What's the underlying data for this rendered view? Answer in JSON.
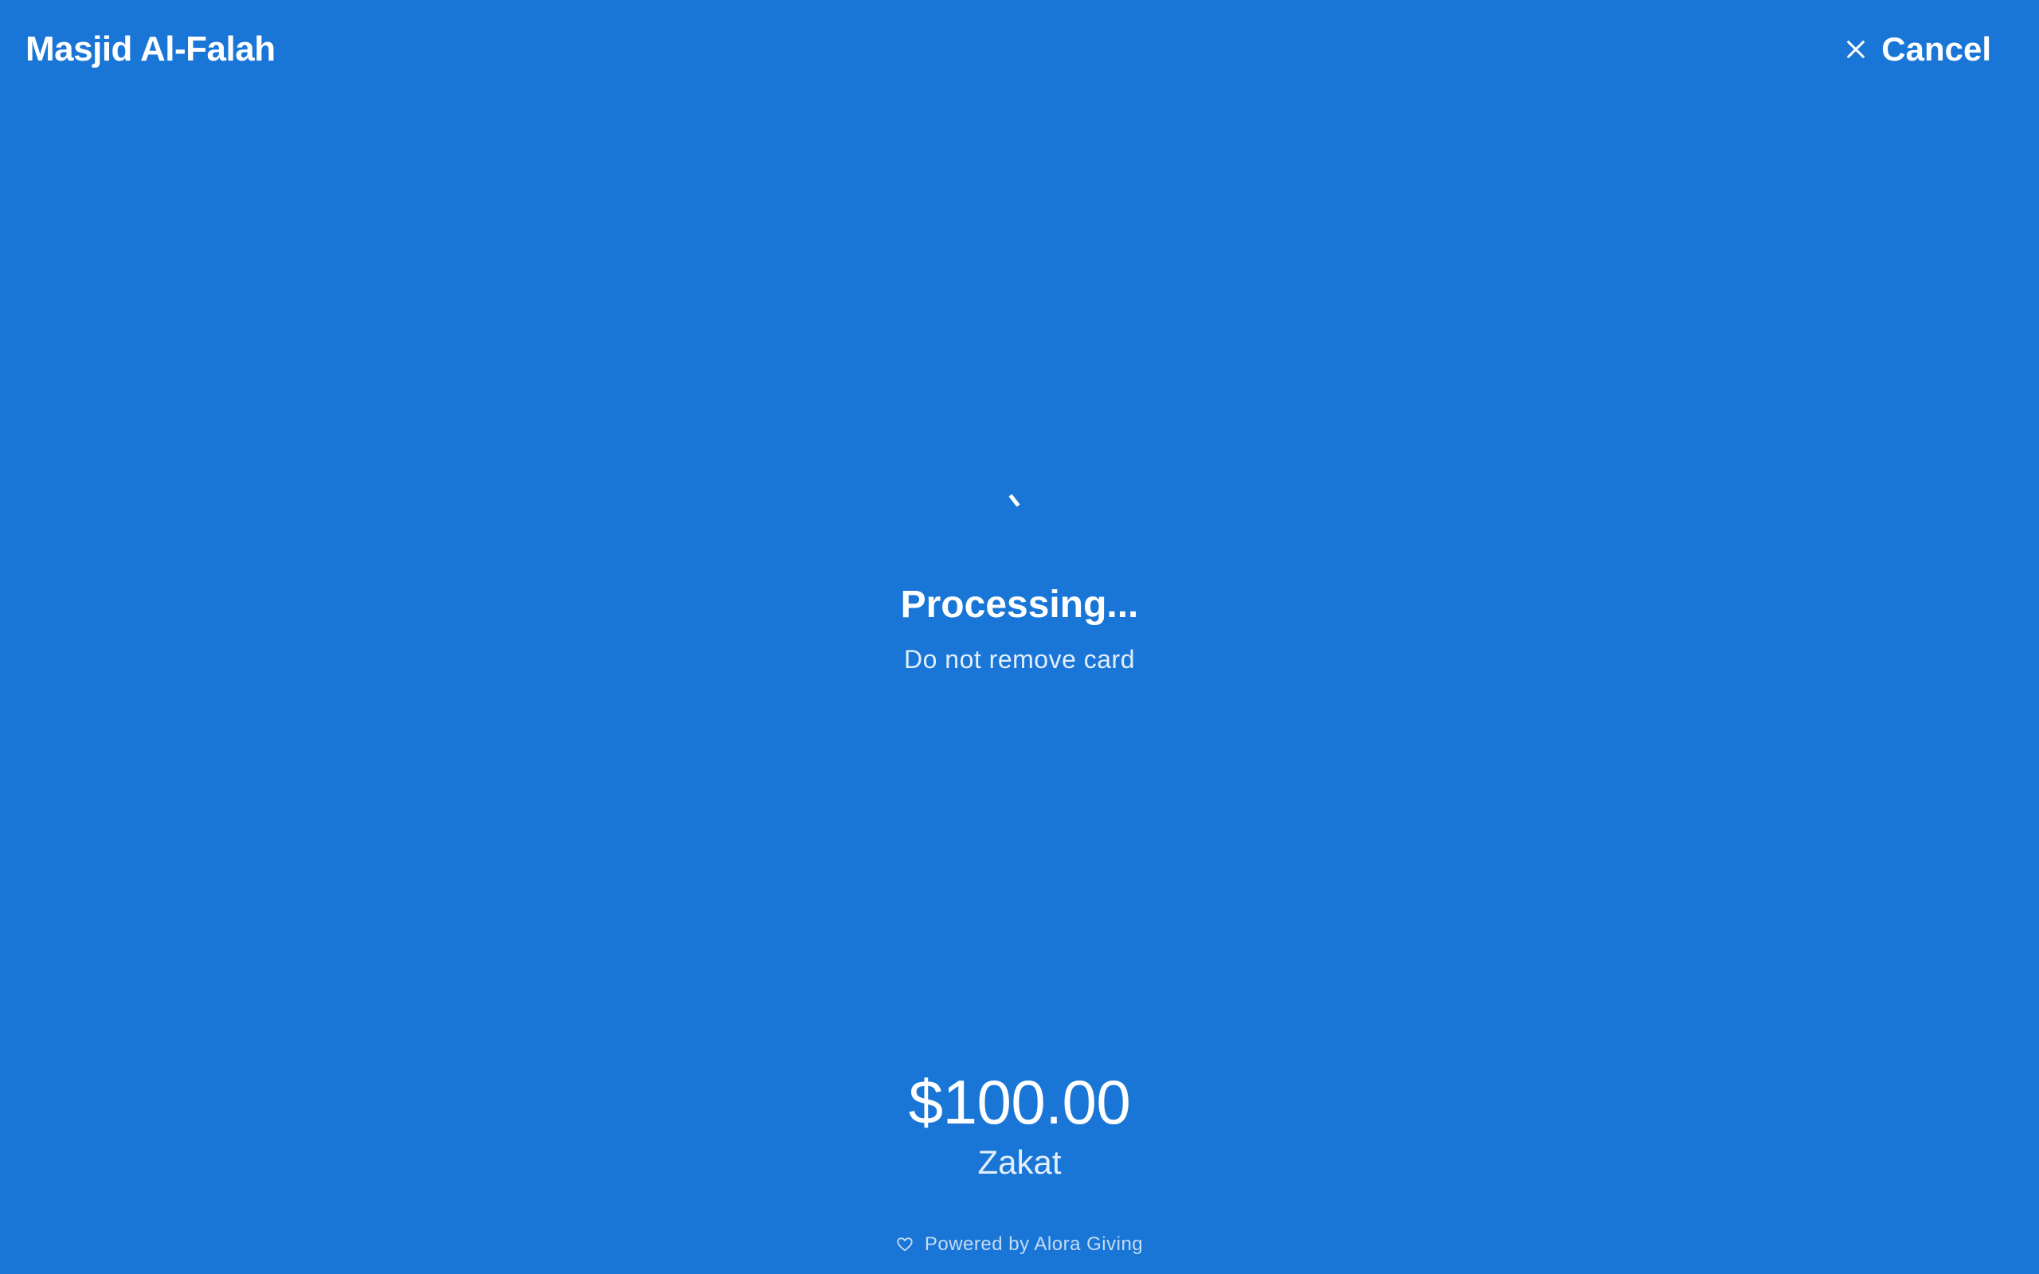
{
  "header": {
    "org_name": "Masjid Al-Falah",
    "cancel_label": "Cancel"
  },
  "status": {
    "title": "Processing...",
    "subtitle": "Do not remove card"
  },
  "donation": {
    "amount": "$100.00",
    "fund": "Zakat"
  },
  "footer": {
    "powered_by": "Powered by Alora Giving"
  },
  "icons": {
    "cancel": "close-icon",
    "spinner": "loading-spinner-icon",
    "footer": "heart-icon"
  },
  "colors": {
    "background": "#1976d6",
    "text": "#ffffff",
    "muted_text": "#e3eefb",
    "footer_text": "#c4dbf5"
  }
}
